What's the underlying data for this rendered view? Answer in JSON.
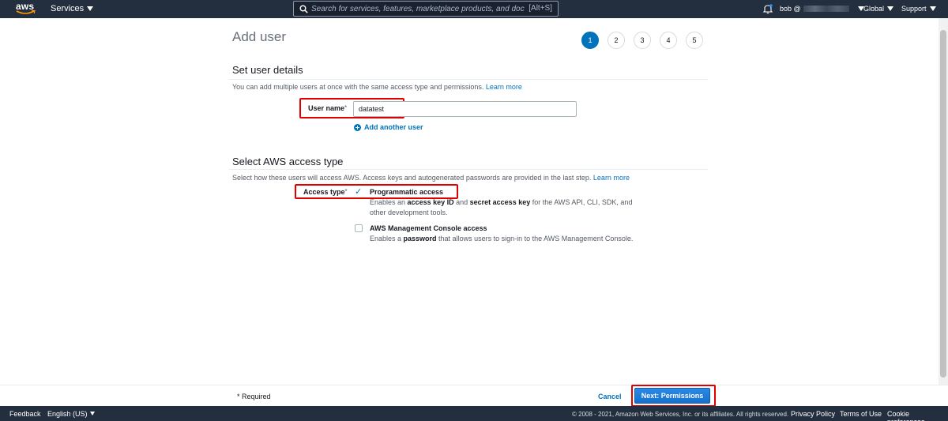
{
  "topnav": {
    "logo_text": "aws",
    "services_label": "Services",
    "search_placeholder": "Search for services, features, marketplace products, and docs",
    "search_shortcut": "[Alt+S]",
    "user_label": "bob @",
    "region_label": "Global",
    "support_label": "Support"
  },
  "page": {
    "title": "Add user",
    "steps": [
      "1",
      "2",
      "3",
      "4",
      "5"
    ],
    "active_step": "1"
  },
  "user_details": {
    "heading": "Set user details",
    "description": "You can add multiple users at once with the same access type and permissions.",
    "learn_more": "Learn more",
    "username_label": "User name",
    "required_marker": "*",
    "username_value": "datatest",
    "add_another": "Add another user"
  },
  "access_type": {
    "heading": "Select AWS access type",
    "description": "Select how these users will access AWS. Access keys and autogenerated passwords are provided in the last step.",
    "learn_more": "Learn more",
    "label": "Access type",
    "required_marker": "*",
    "programmatic": {
      "title": "Programmatic access",
      "checked": true,
      "desc_1": "Enables an ",
      "desc_b1": "access key ID",
      "desc_2": " and ",
      "desc_b2": "secret access key",
      "desc_3": " for the AWS API, CLI, SDK, and",
      "desc_4": "other development tools."
    },
    "console": {
      "title": "AWS Management Console access",
      "checked": false,
      "desc_1": "Enables a ",
      "desc_b1": "password",
      "desc_2": " that allows users to sign-in to the AWS Management Console."
    }
  },
  "actions": {
    "required_note": "* Required",
    "cancel": "Cancel",
    "next": "Next: Permissions"
  },
  "footer": {
    "feedback": "Feedback",
    "language": "English (US)",
    "copyright": "© 2008 - 2021, Amazon Web Services, Inc. or its affiliates. All rights reserved.",
    "privacy": "Privacy Policy",
    "terms": "Terms of Use",
    "cookies": "Cookie preferences"
  },
  "colors": {
    "nav_bg": "#232f3e",
    "link": "#0073bb",
    "primary_button": "#1470cc",
    "highlight": "#e00000"
  }
}
